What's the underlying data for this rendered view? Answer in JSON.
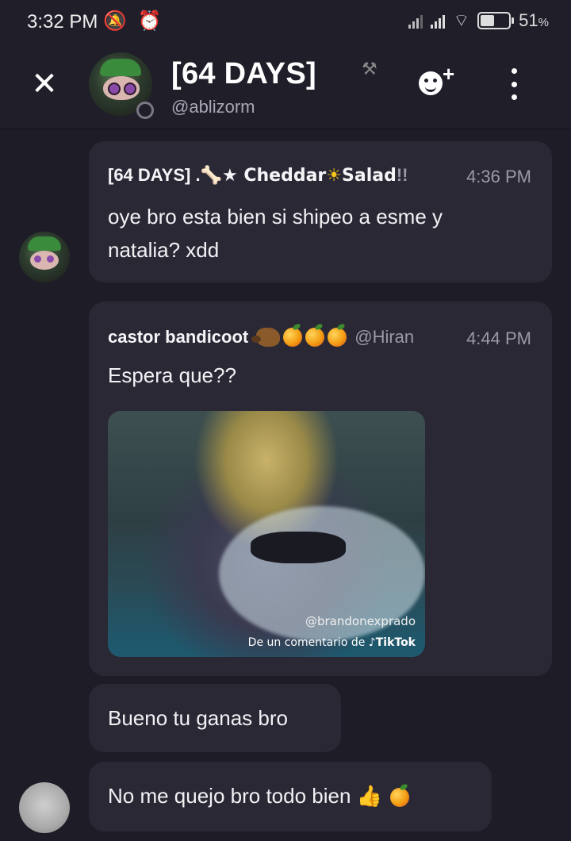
{
  "status_bar": {
    "time": "3:32 PM",
    "battery_percent": "51",
    "battery_suffix": "%",
    "battery_level": 0.51
  },
  "header": {
    "title": "[64 DAYS]",
    "username": "@ablizorm",
    "close_icon": "close-icon",
    "add_member_icon": "add-member-icon",
    "menu_icon": "more-vertical-icon"
  },
  "messages": [
    {
      "author_prefix": "[64 DAYS] .",
      "author_name": "★ Cheddar",
      "author_suffix": "Salad",
      "author_end": "!!",
      "time": "4:36 PM",
      "text_line1": "oye bro esta bien si shipeo a esme y",
      "text_line2": "natalia? xdd"
    },
    {
      "author": "castor bandicoot",
      "handle": "@Hiran",
      "time": "4:44 PM",
      "text": "Espera que??",
      "gif_handle": "@brandonexprado",
      "gif_credit_prefix": "De un comentario de",
      "gif_credit_brand": "TikTok"
    },
    {
      "text": "Bueno tu ganas bro"
    },
    {
      "text": "No me quejo bro todo bien 👍"
    }
  ],
  "colors": {
    "background": "#1e1c27",
    "bubble": "#2a2835",
    "header": "#201e29",
    "muted_text": "#9b99a6"
  }
}
